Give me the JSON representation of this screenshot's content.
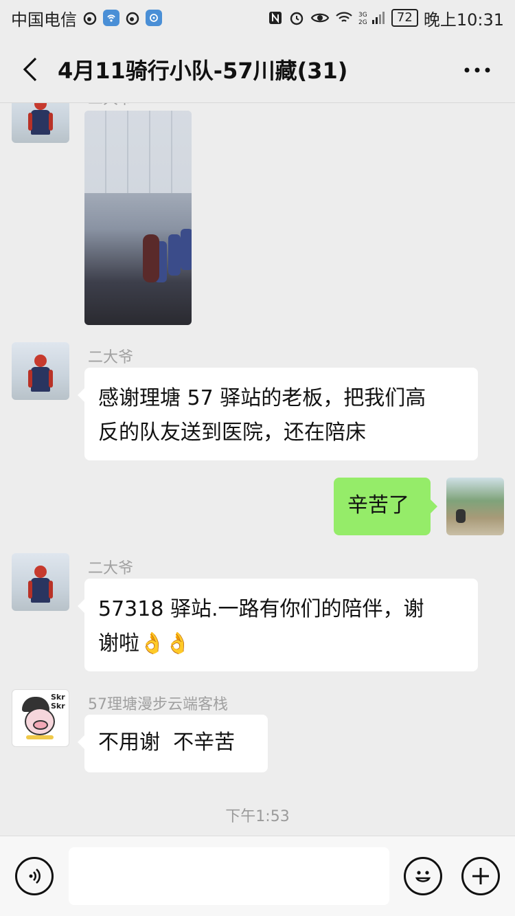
{
  "status_bar": {
    "carrier": "中国电信",
    "battery": "72",
    "time": "晚上10:31",
    "icons": [
      "weibo-icon",
      "wifi-hotspot-icon",
      "weibo-icon",
      "app-icon",
      "nfc-icon",
      "alarm-icon",
      "eye-icon",
      "wifi-icon",
      "signal-icon"
    ]
  },
  "header": {
    "title": "4月11骑行小队-57川藏(31)",
    "back_icon": "chevron-left-icon",
    "more_icon": "more-dots-icon"
  },
  "messages": [
    {
      "type": "image",
      "side": "left",
      "sender": "二大爷",
      "avatar": "rider-avatar"
    },
    {
      "type": "text",
      "side": "left",
      "sender": "二大爷",
      "avatar": "rider-avatar",
      "lines": [
        "感谢理塘 57 驿站的老板，把我们高",
        "反的队友送到医院，还在陪床"
      ]
    },
    {
      "type": "text",
      "side": "right",
      "avatar": "lake-avatar",
      "lines": [
        "辛苦了"
      ]
    },
    {
      "type": "text",
      "side": "left",
      "sender": "二大爷",
      "avatar": "rider-avatar",
      "lines": [
        "57318 驿站.一路有你们的陪伴，谢",
        "谢啦"
      ],
      "emoji": "👌👌"
    },
    {
      "type": "text",
      "side": "left",
      "sender": "57理塘漫步云端客栈",
      "avatar": "pig-avatar",
      "lines": [
        "不用谢  不辛苦"
      ],
      "avatar_text": "Skr Skr"
    }
  ],
  "timestamp": "下午1:53",
  "input_bar": {
    "voice_icon": "voice-icon",
    "emoji_icon": "emoji-icon",
    "plus_icon": "plus-icon"
  }
}
